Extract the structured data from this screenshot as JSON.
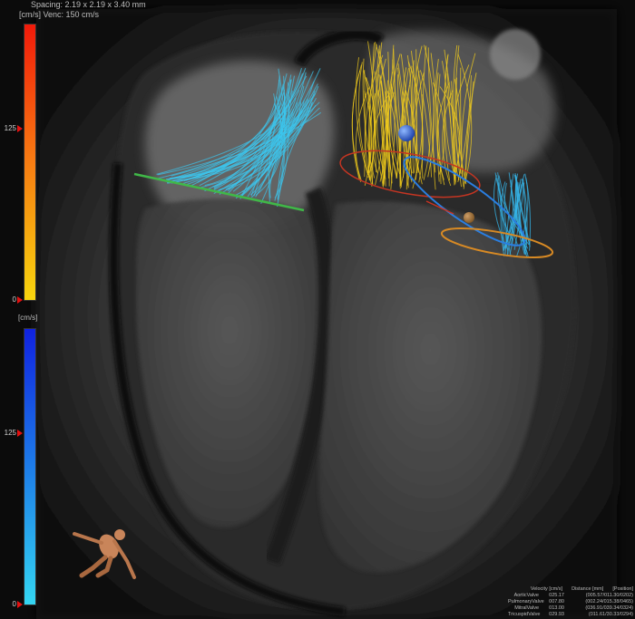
{
  "header": {
    "spacing": "Spacing: 2.19 x 2.19 x 3.40 mm",
    "venc": "Venc: 150 cm/s"
  },
  "colorbar_top": {
    "unit": "[cm/s]",
    "ticks": [
      "125",
      "0"
    ],
    "colors": [
      "#f21a0a",
      "#f77c12",
      "#f7d50e"
    ]
  },
  "colorbar_bottom": {
    "unit": "[cm/s]",
    "ticks": [
      "125",
      "0"
    ],
    "colors": [
      "#1022e0",
      "#1d7ce8",
      "#34d6f2"
    ]
  },
  "legend": {
    "header": [
      "Velocity [cm/s]",
      "Distance [mm]",
      "[Position]"
    ],
    "rows": [
      [
        "AorticValve",
        "025.17",
        "(005.57/011.30/0202)"
      ],
      [
        "PulmonaryValve",
        "007.80",
        "(002.24/015.38/0465)"
      ],
      [
        "MitralValve",
        "013.00",
        "(036.91/039.34/0324)"
      ],
      [
        "TricuspidValve",
        "029.93",
        "(011.61/30.33/0294)"
      ]
    ]
  },
  "overlay_colors": {
    "pulmonary_streamlines": "#f5cf1b",
    "aortic_streamlines": "#3cc6ee",
    "tricuspid_streamlines": "#36b6ea",
    "valve_ring_red": "#cc3322",
    "valve_ring_blue": "#2a7ee0",
    "valve_ring_orange": "#d88a24",
    "valve_plane_green": "#40b848",
    "position_sphere": "#2f6fe0"
  },
  "icons": {
    "orientation": "human-figure-orientation-icon",
    "marker": "red-triangle-marker-icon"
  }
}
